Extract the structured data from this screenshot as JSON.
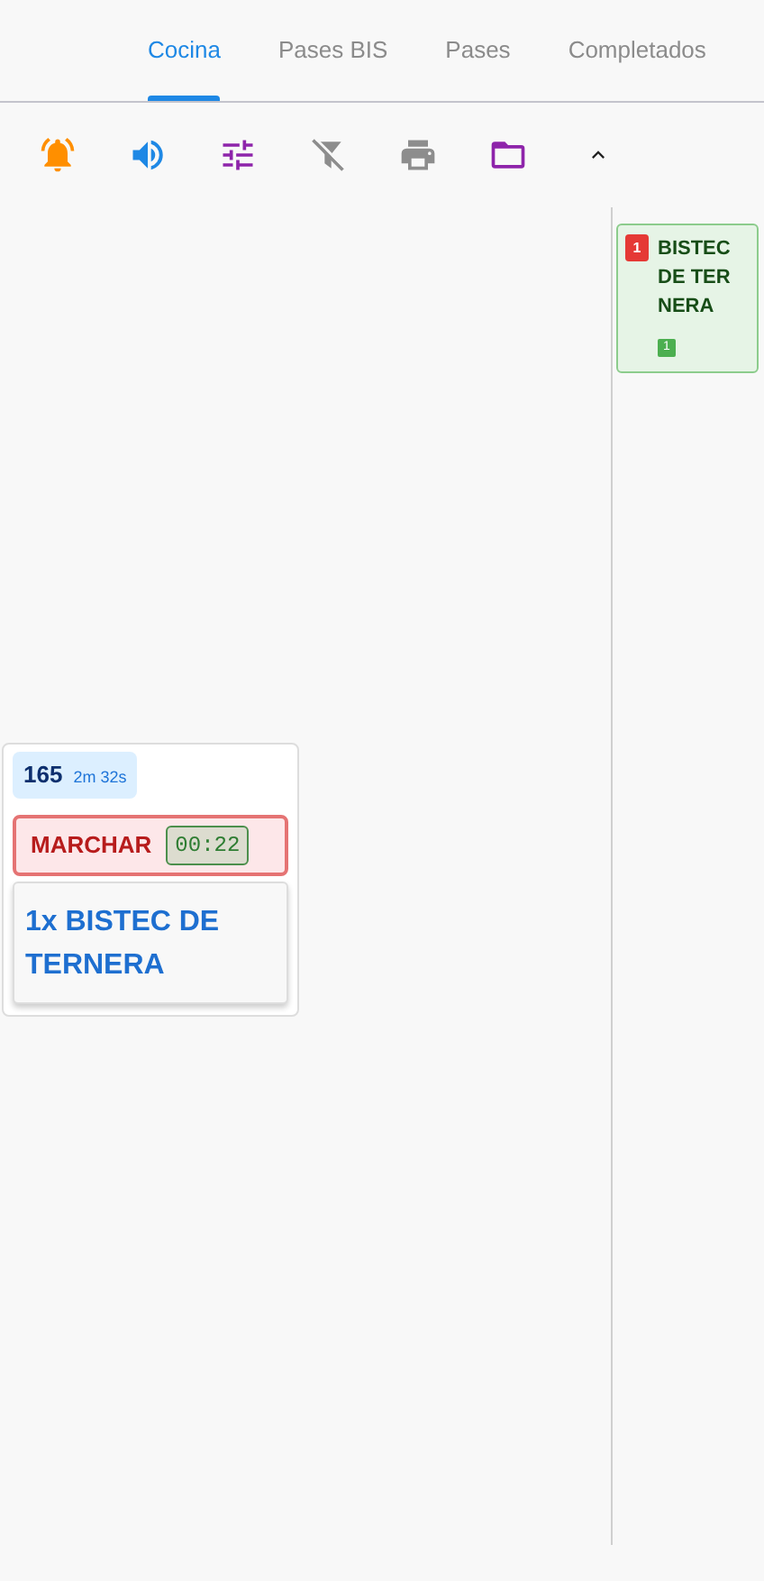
{
  "tabs": [
    {
      "label": "Cocina",
      "selected": true
    },
    {
      "label": "Pases BIS",
      "selected": false
    },
    {
      "label": "Pases",
      "selected": false
    },
    {
      "label": "Completados",
      "selected": false
    }
  ],
  "orders": [
    {
      "number": "165",
      "elapsed": "2m 32s",
      "status": "MARCHAR",
      "timer": "00:22",
      "items": [
        "1x BISTEC DE TERNERA"
      ]
    }
  ],
  "summary": [
    {
      "count": "1",
      "name": "BISTEC DE TERNERA",
      "done_count": "1"
    }
  ]
}
